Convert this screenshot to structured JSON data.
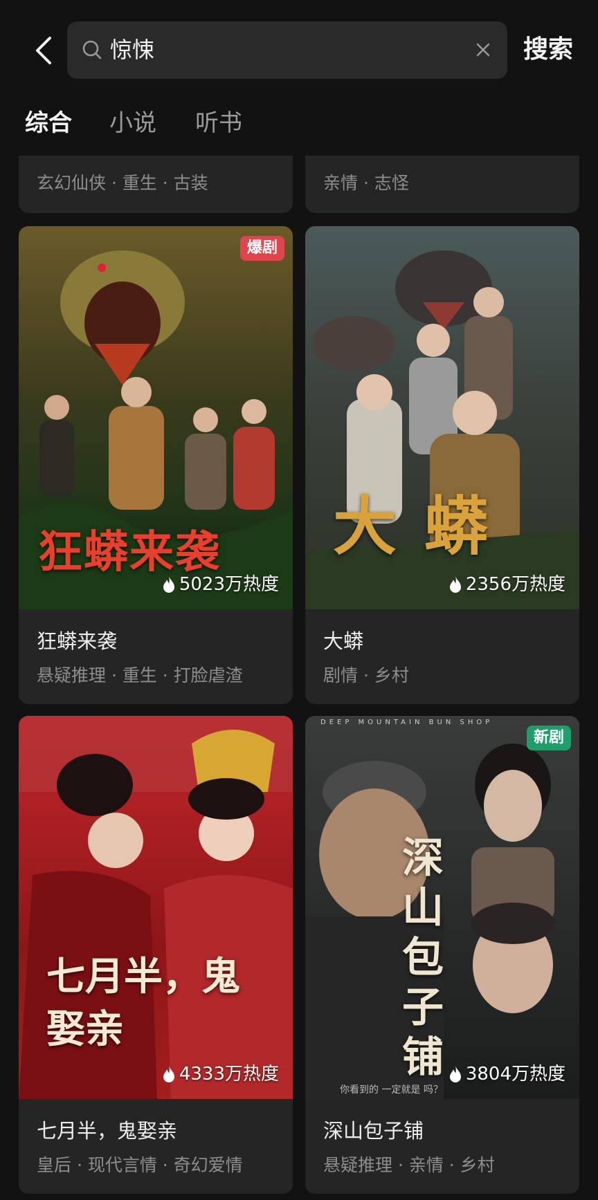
{
  "search": {
    "query": "惊悚",
    "button_label": "搜索"
  },
  "tabs": [
    {
      "label": "综合",
      "active": true
    },
    {
      "label": "小说",
      "active": false
    },
    {
      "label": "听书",
      "active": false
    }
  ],
  "top_partial_cards": [
    {
      "tags": "玄幻仙侠 · 重生 · 古装"
    },
    {
      "tags": "亲情 · 志怪"
    }
  ],
  "cards": [
    {
      "title": "狂蟒来袭",
      "tags": "悬疑推理 · 重生 · 打脸虐渣",
      "heat": "5023万热度",
      "badge": "爆剧",
      "badge_color": "#e0454f",
      "poster_title": "狂蟒来袭"
    },
    {
      "title": "大蟒",
      "tags": "剧情 · 乡村",
      "heat": "2356万热度",
      "badge": "",
      "badge_color": "",
      "poster_title": "大蟒"
    },
    {
      "title": "七月半，鬼娶亲",
      "tags": "皇后 · 现代言情 · 奇幻爱情",
      "heat": "4333万热度",
      "badge": "",
      "badge_color": "",
      "poster_title": "七月半，鬼娶亲"
    },
    {
      "title": "深山包子铺",
      "tags": "悬疑推理 · 亲情 · 乡村",
      "heat": "3804万热度",
      "badge": "新剧",
      "badge_color": "#1f9d6a",
      "poster_title": "深山包子铺",
      "poster_subtitle": "DEEP MOUNTAIN BUN SHOP",
      "poster_tagline": "你看到的 一定就是 吗？"
    }
  ]
}
